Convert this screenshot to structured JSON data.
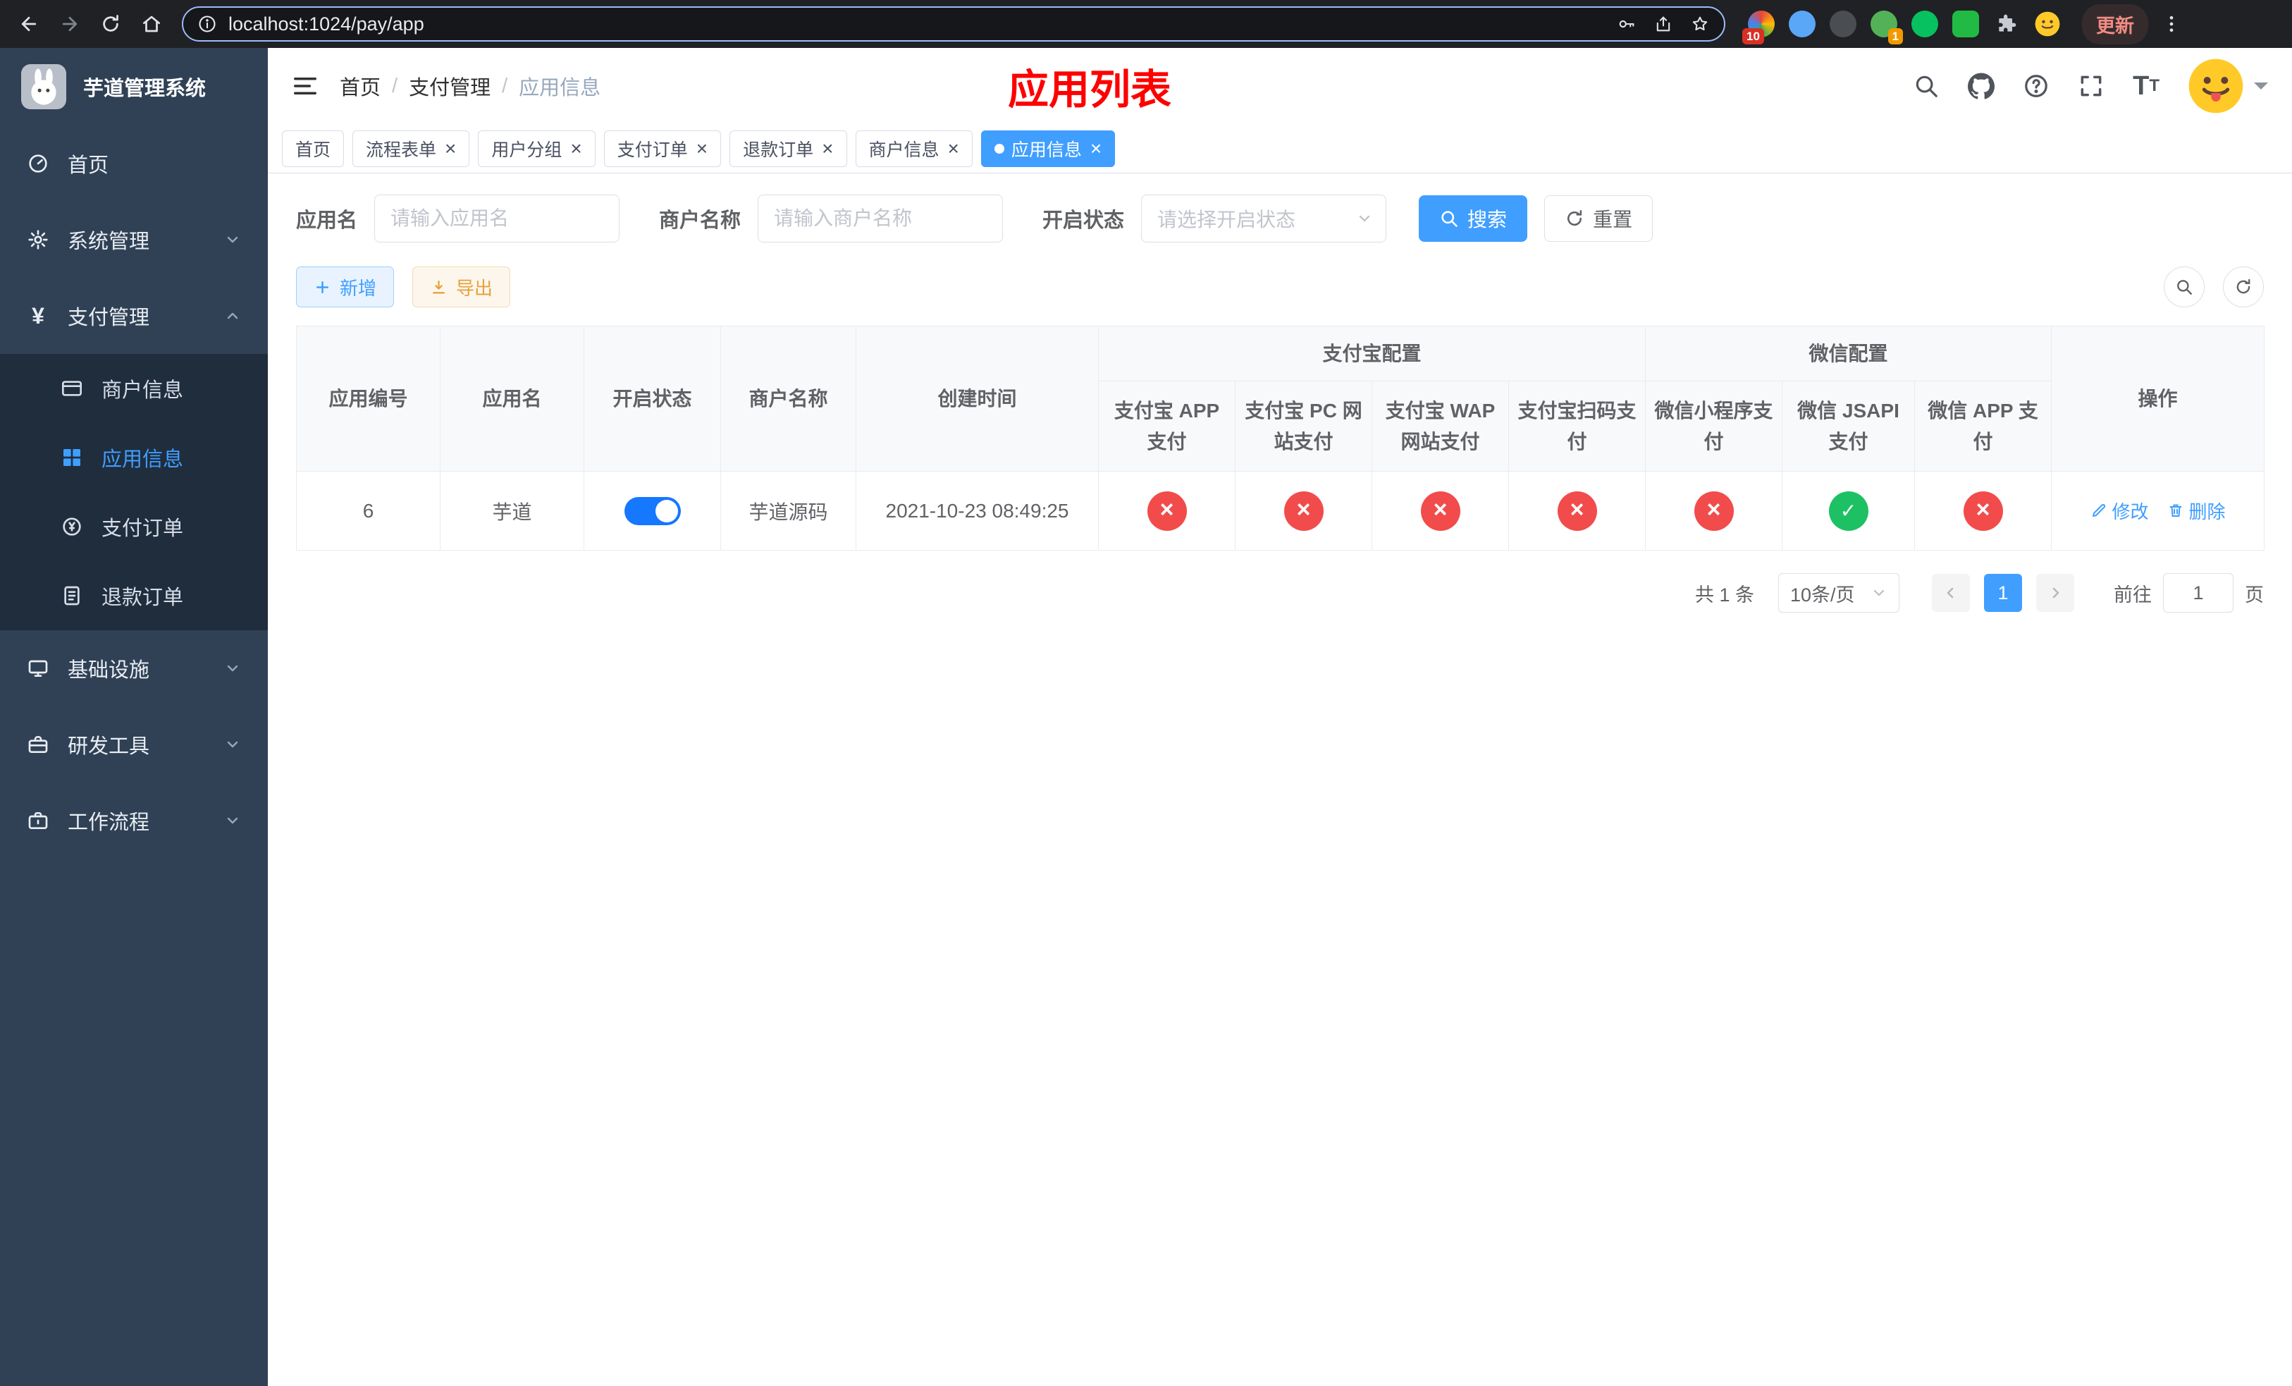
{
  "browser": {
    "url": "localhost:1024/pay/app",
    "update_label": "更新",
    "ext_badges": {
      "grid": "10",
      "green": "1"
    }
  },
  "sidebar": {
    "logo_title": "芋道管理系统",
    "active_item": "应用信息",
    "menu": [
      {
        "label": "首页"
      },
      {
        "label": "系统管理"
      },
      {
        "label": "支付管理"
      },
      {
        "label": "商户信息"
      },
      {
        "label": "应用信息"
      },
      {
        "label": "支付订单"
      },
      {
        "label": "退款订单"
      },
      {
        "label": "基础设施"
      },
      {
        "label": "研发工具"
      },
      {
        "label": "工作流程"
      }
    ]
  },
  "header": {
    "breadcrumb": [
      "首页",
      "支付管理",
      "应用信息"
    ],
    "page_title": "应用列表"
  },
  "tabs": [
    {
      "label": "首页",
      "closable": false,
      "active": false
    },
    {
      "label": "流程表单",
      "closable": true,
      "active": false
    },
    {
      "label": "用户分组",
      "closable": true,
      "active": false
    },
    {
      "label": "支付订单",
      "closable": true,
      "active": false
    },
    {
      "label": "退款订单",
      "closable": true,
      "active": false
    },
    {
      "label": "商户信息",
      "closable": true,
      "active": false
    },
    {
      "label": "应用信息",
      "closable": true,
      "active": true
    }
  ],
  "filters": {
    "app_name_label": "应用名",
    "app_name_placeholder": "请输入应用名",
    "merchant_label": "商户名称",
    "merchant_placeholder": "请输入商户名称",
    "status_label": "开启状态",
    "status_placeholder": "请选择开启状态",
    "search_button": "搜索",
    "reset_button": "重置"
  },
  "toolbar": {
    "add_button": "新增",
    "export_button": "导出"
  },
  "table": {
    "columns": {
      "id": "应用编号",
      "name": "应用名",
      "status": "开启状态",
      "merchant": "商户名称",
      "created": "创建时间",
      "alipay_group": "支付宝配置",
      "wechat_group": "微信配置",
      "actions": "操作",
      "sub": [
        "支付宝 APP 支付",
        "支付宝 PC 网站支付",
        "支付宝 WAP 网站支付",
        "支付宝扫码支付",
        "微信小程序支付",
        "微信 JSAPI 支付",
        "微信 APP 支付"
      ]
    },
    "row": {
      "id": "6",
      "name": "芋道",
      "status_on": true,
      "merchant": "芋道源码",
      "created": "2021-10-23 08:49:25",
      "configs": [
        false,
        false,
        false,
        false,
        false,
        true,
        false
      ],
      "edit_label": "修改",
      "delete_label": "删除"
    }
  },
  "pagination": {
    "total": "共 1 条",
    "page_size": "10条/页",
    "current_page": "1",
    "goto_label": "前往",
    "goto_value": "1",
    "page_unit": "页"
  },
  "colors": {
    "accent": "#409eff",
    "toggle_on": "#1677ff",
    "danger": "#f24b4b",
    "success": "#1dc163",
    "warning": "#e6a23c",
    "title_red": "#fe0000",
    "sidebar_bg": "#304156",
    "submenu_bg": "#1f2d3d"
  }
}
